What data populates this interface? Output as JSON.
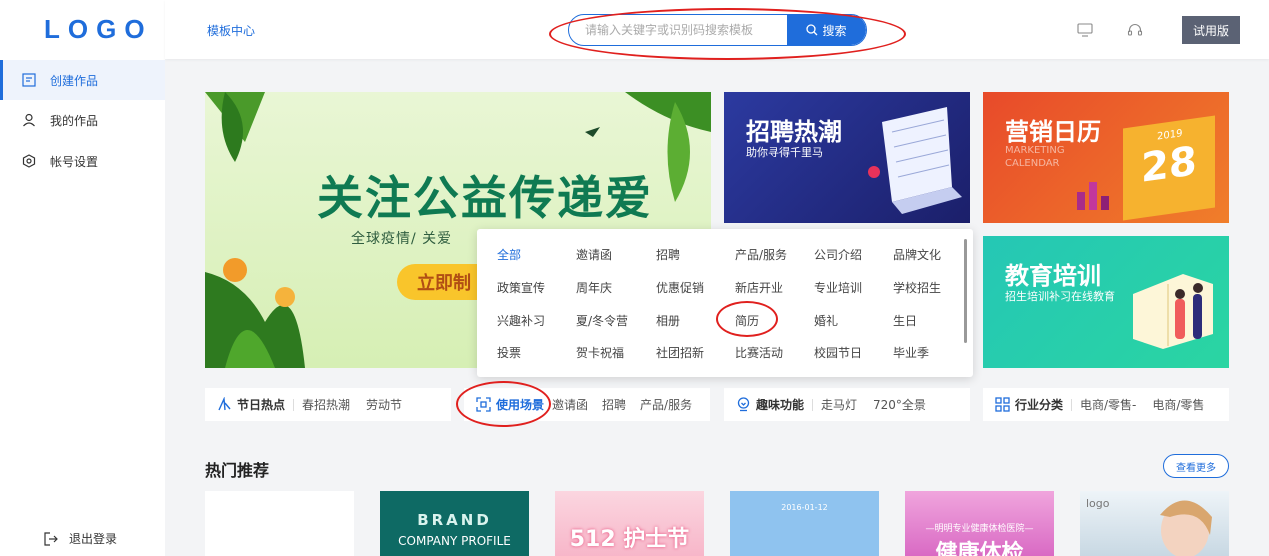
{
  "app": {
    "logo": "LOGO"
  },
  "sidebar": {
    "items": [
      {
        "label": "创建作品",
        "icon": "create-icon"
      },
      {
        "label": "我的作品",
        "icon": "user-icon"
      },
      {
        "label": "帐号设置",
        "icon": "settings-icon"
      }
    ],
    "logout": "退出登录"
  },
  "header": {
    "breadcrumb": "模板中心",
    "search": {
      "placeholder": "请输入关键字或识别码搜索模板",
      "button": "搜索"
    },
    "trial": "试用版"
  },
  "banners": {
    "main": {
      "title": "关注公益传递爱",
      "subtitle": "全球疫情/ 关爱",
      "button": "立即制"
    },
    "recruit": {
      "title": "招聘热潮",
      "subtitle": "助你寻得千里马"
    },
    "calendar": {
      "title": "营销日历",
      "subtitle": "MARKETING\nCALENDAR",
      "year": "2019",
      "day": "28"
    },
    "education": {
      "title": "教育培训",
      "subtitle": "招生培训补习在线教育"
    }
  },
  "categories": [
    {
      "head": "节日热点",
      "icon": "festival-icon",
      "tags": [
        "春招热潮",
        "劳动节"
      ]
    },
    {
      "head": "使用场景",
      "icon": "scene-icon",
      "tags": [
        "邀请函",
        "招聘",
        "产品/服务"
      ]
    },
    {
      "head": "趣味功能",
      "icon": "fun-icon",
      "tags": [
        "走马灯",
        "720°全景"
      ]
    },
    {
      "head": "行业分类",
      "icon": "industry-icon",
      "tags": [
        "电商/零售-",
        "电商/零售"
      ]
    }
  ],
  "dropdown": {
    "rows": [
      [
        "全部",
        "邀请函",
        "招聘",
        "产品/服务",
        "公司介绍",
        "品牌文化"
      ],
      [
        "政策宣传",
        "周年庆",
        "优惠促销",
        "新店开业",
        "专业培训",
        "学校招生"
      ],
      [
        "兴趣补习",
        "夏/冬令营",
        "相册",
        "简历",
        "婚礼",
        "生日"
      ],
      [
        "投票",
        "贺卡祝福",
        "社团招新",
        "比赛活动",
        "校园节日",
        "毕业季"
      ]
    ]
  },
  "hot": {
    "title": "热门推荐",
    "more": "查看更多",
    "cards": [
      {
        "text": ""
      },
      {
        "text": "BRAND",
        "sub": "COMPANY PROFILE"
      },
      {
        "text": "512 护士节"
      },
      {
        "text": "2016-01-12"
      },
      {
        "text": "—明明专业健康体检医院—",
        "sub": "健康体检"
      },
      {
        "text": "logo"
      }
    ]
  },
  "colors": {
    "accent": "#1f6ddb",
    "highlight_red": "#e0201e"
  }
}
